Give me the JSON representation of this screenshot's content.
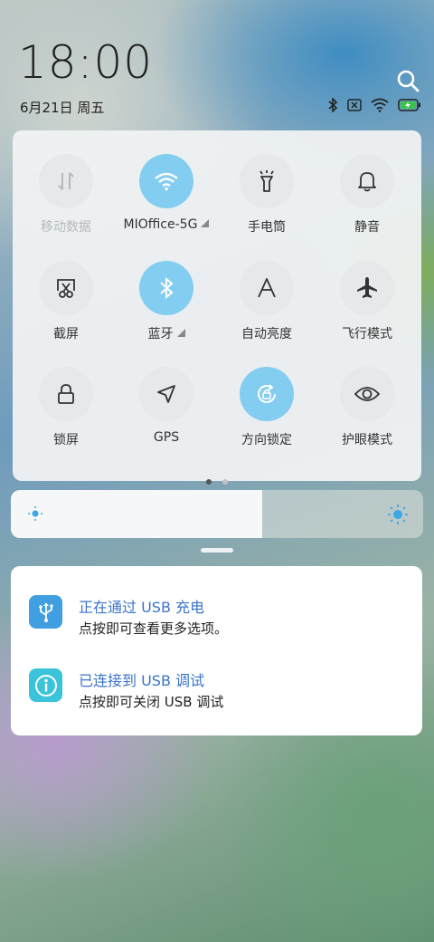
{
  "status": {
    "time": "18:00",
    "date": "6月21日 周五"
  },
  "quick_settings": {
    "tiles": [
      {
        "label": "移动数据",
        "icon": "mobile-data-icon",
        "active": false,
        "dim": true
      },
      {
        "label": "MIOffice-5G",
        "icon": "wifi-icon",
        "active": true,
        "expandable": true
      },
      {
        "label": "手电筒",
        "icon": "flashlight-icon",
        "active": false
      },
      {
        "label": "静音",
        "icon": "bell-icon",
        "active": false
      },
      {
        "label": "截屏",
        "icon": "screenshot-icon",
        "active": false
      },
      {
        "label": "蓝牙",
        "icon": "bluetooth-icon",
        "active": true,
        "expandable": true
      },
      {
        "label": "自动亮度",
        "icon": "auto-brightness-icon",
        "active": false
      },
      {
        "label": "飞行模式",
        "icon": "airplane-icon",
        "active": false
      },
      {
        "label": "锁屏",
        "icon": "lock-icon",
        "active": false
      },
      {
        "label": "GPS",
        "icon": "gps-icon",
        "active": false
      },
      {
        "label": "方向锁定",
        "icon": "rotation-lock-icon",
        "active": true
      },
      {
        "label": "护眼模式",
        "icon": "eye-icon",
        "active": false
      }
    ],
    "page_count": 2,
    "current_page": 1
  },
  "brightness": {
    "level": 0.61
  },
  "notifications": [
    {
      "title": "正在通过 USB 充电",
      "text": "点按即可查看更多选项。",
      "icon": "usb-icon",
      "color": "#3f9fe0"
    },
    {
      "title": "已连接到 USB 调试",
      "text": "点按即可关闭 USB 调试",
      "icon": "info-icon",
      "color": "#3ac3d9"
    }
  ],
  "colors": {
    "accent": "#83cdf1",
    "notification_title": "#3a73c9"
  }
}
